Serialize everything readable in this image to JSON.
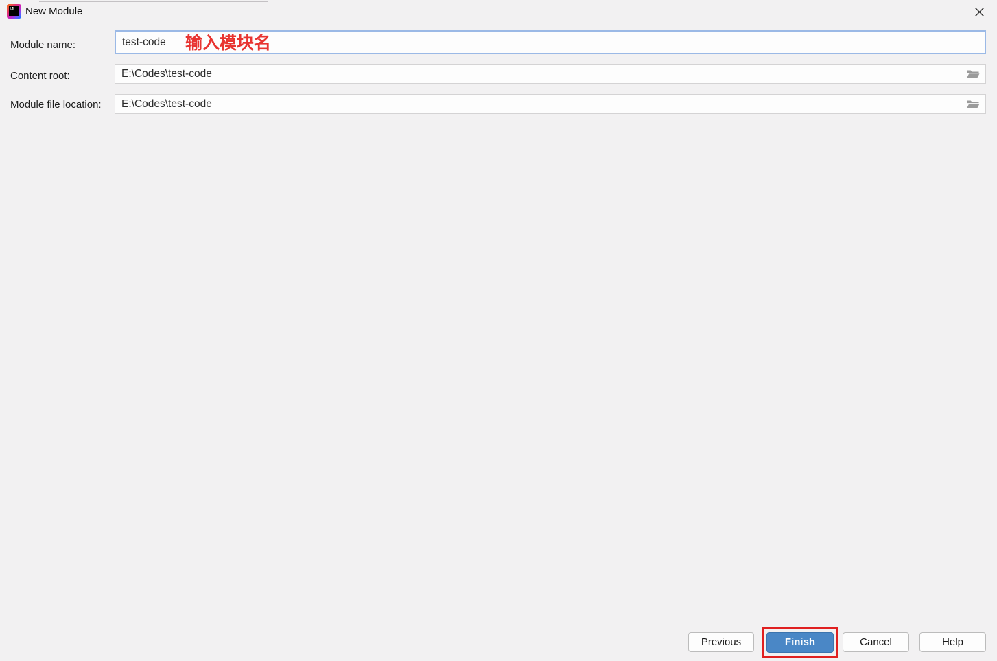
{
  "window": {
    "title": "New Module",
    "logo_text": "IJ",
    "icons": {
      "app": "intellij-idea-logo",
      "close": "x-cross",
      "browse": "folder-open"
    }
  },
  "form": {
    "fields": [
      {
        "label": "Module name:",
        "value": "test-code",
        "focused": true,
        "annotation": "输入模块名"
      },
      {
        "label": "Content root:",
        "value": "E:\\Codes\\test-code",
        "browse_icon": "folder-open-icon"
      },
      {
        "label": "Module file location:",
        "value": "E:\\Codes\\test-code",
        "browse_icon": "folder-open-icon"
      }
    ]
  },
  "buttons": {
    "previous": "Previous",
    "finish": "Finish",
    "cancel": "Cancel",
    "help": "Help"
  },
  "annotations": {
    "module_name_hint": "输入模块名",
    "finish_highlight": "red-rectangle"
  },
  "colors": {
    "background": "#f2f1f2",
    "focus_border": "#9bb9e6",
    "finish_blue": "#4a87c6",
    "annotation_red": "#e02020",
    "field_background": "#fdfdfd"
  }
}
